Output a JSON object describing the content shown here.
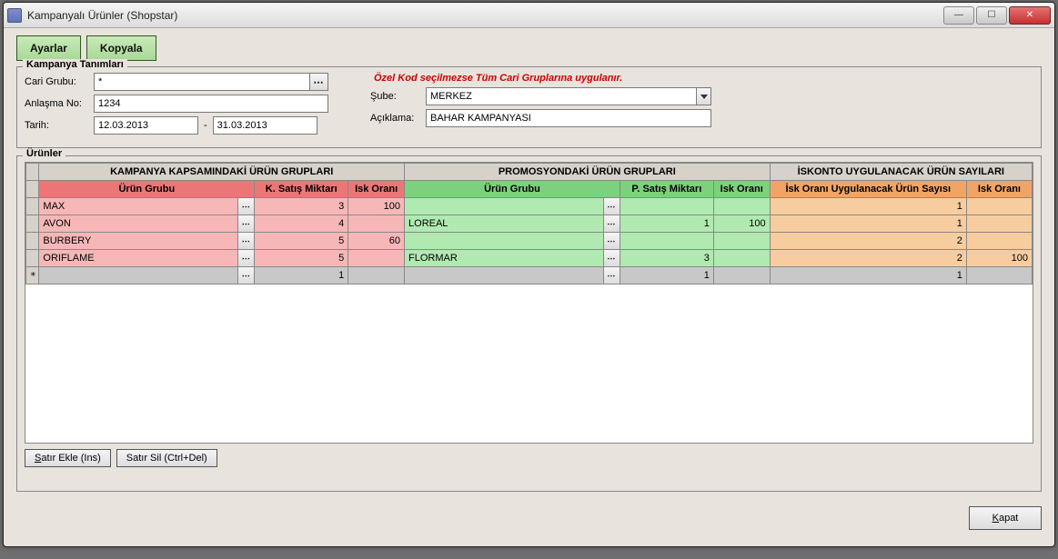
{
  "window": {
    "title": "Kampanyalı Ürünler (Shopstar)"
  },
  "buttons": {
    "settings": "Ayarlar",
    "copy": "Kopyala",
    "add_row": "Satır Ekle (Ins)",
    "del_row": "Satır Sil (Ctrl+Del)",
    "close": "Kapat"
  },
  "group1": {
    "legend": "Kampanya Tanımları",
    "cari_grubu_label": "Cari Grubu:",
    "cari_grubu_value": "*",
    "note": "Özel Kod seçilmezse Tüm Cari Gruplarına uygulanır.",
    "anlasma_label": "Anlaşma No:",
    "anlasma_value": "1234",
    "sube_label": "Şube:",
    "sube_value": "MERKEZ",
    "tarih_label": "Tarih:",
    "tarih_from": "12.03.2013",
    "tarih_sep": "-",
    "tarih_to": "31.03.2013",
    "aciklama_label": "Açıklama:",
    "aciklama_value": "BAHAR KAMPANYASI"
  },
  "group2": {
    "legend": "Ürünler"
  },
  "table": {
    "top_headers": {
      "a": "KAMPANYA KAPSAMINDAKİ ÜRÜN GRUPLARI",
      "b": "PROMOSYONDAKİ ÜRÜN GRUPLARI",
      "c": "İSKONTO UYGULANACAK ÜRÜN SAYILARI"
    },
    "headers": {
      "a1": "Ürün Grubu",
      "a2": "K. Satış Miktarı",
      "a3": "Isk Oranı",
      "b1": "Ürün Grubu",
      "b2": "P. Satış Miktarı",
      "b3": "Isk Oranı",
      "c1": "İsk Oranı Uygulanacak Ürün Sayısı",
      "c2": "Isk Oranı"
    },
    "rows": [
      {
        "a_grp": "MAX",
        "a_qty": "3",
        "a_isk": "100",
        "b_grp": "",
        "b_qty": "",
        "b_isk": "",
        "c_qty": "1",
        "c_isk": ""
      },
      {
        "a_grp": "AVON",
        "a_qty": "4",
        "a_isk": "",
        "b_grp": "LOREAL",
        "b_qty": "1",
        "b_isk": "100",
        "c_qty": "1",
        "c_isk": ""
      },
      {
        "a_grp": "BURBERY",
        "a_qty": "5",
        "a_isk": "60",
        "b_grp": "",
        "b_qty": "",
        "b_isk": "",
        "c_qty": "2",
        "c_isk": ""
      },
      {
        "a_grp": "ORIFLAME",
        "a_qty": "5",
        "a_isk": "",
        "b_grp": "FLORMAR",
        "b_qty": "3",
        "b_isk": "",
        "c_qty": "2",
        "c_isk": "100"
      }
    ],
    "empty_row": {
      "marker": "*",
      "a_qty": "1",
      "b_qty": "1",
      "c_qty": "1"
    }
  }
}
